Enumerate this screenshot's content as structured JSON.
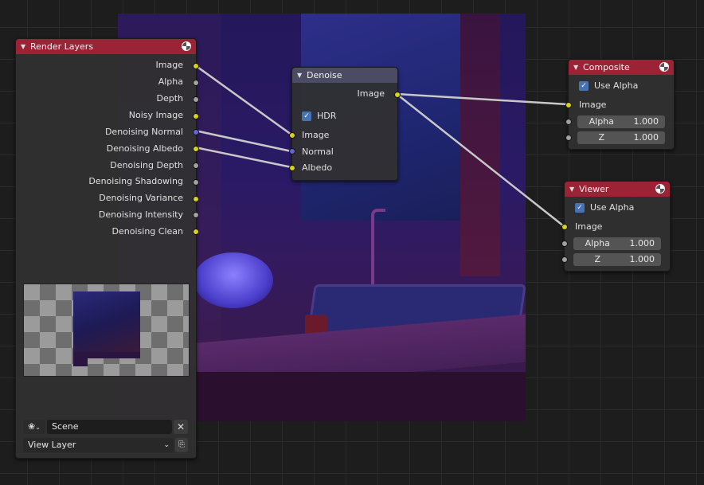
{
  "colors": {
    "header_output_node": "#9b2335",
    "header_filter_node": "#4b4b64",
    "socket_color": "#d9d21b",
    "socket_float": "#a1a1a1",
    "socket_vector": "#6464d8",
    "checkbox_accent": "#4772b3"
  },
  "render_layers": {
    "title": "Render Layers",
    "outputs": [
      {
        "label": "Image",
        "type": "color"
      },
      {
        "label": "Alpha",
        "type": "float"
      },
      {
        "label": "Depth",
        "type": "float"
      },
      {
        "label": "Noisy Image",
        "type": "color"
      },
      {
        "label": "Denoising Normal",
        "type": "vector"
      },
      {
        "label": "Denoising Albedo",
        "type": "color"
      },
      {
        "label": "Denoising Depth",
        "type": "float"
      },
      {
        "label": "Denoising Shadowing",
        "type": "float"
      },
      {
        "label": "Denoising Variance",
        "type": "color"
      },
      {
        "label": "Denoising Intensity",
        "type": "float"
      },
      {
        "label": "Denoising Clean",
        "type": "color"
      }
    ],
    "scene": "Scene",
    "view_layer": "View Layer"
  },
  "denoise": {
    "title": "Denoise",
    "output": "Image",
    "hdr_label": "HDR",
    "hdr_checked": true,
    "inputs": [
      "Image",
      "Normal",
      "Albedo"
    ]
  },
  "composite": {
    "title": "Composite",
    "use_alpha_label": "Use Alpha",
    "use_alpha": true,
    "input_image": "Image",
    "alpha_label": "Alpha",
    "alpha_value": "1.000",
    "z_label": "Z",
    "z_value": "1.000"
  },
  "viewer": {
    "title": "Viewer",
    "use_alpha_label": "Use Alpha",
    "use_alpha": true,
    "input_image": "Image",
    "alpha_label": "Alpha",
    "alpha_value": "1.000",
    "z_label": "Z",
    "z_value": "1.000"
  }
}
